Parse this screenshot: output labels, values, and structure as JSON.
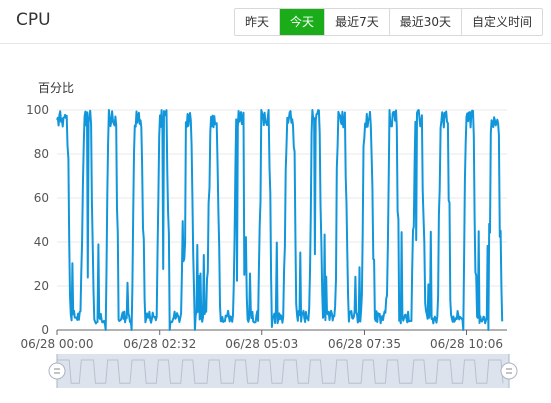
{
  "header": {
    "title": "CPU",
    "range_tabs": [
      {
        "label": "昨天",
        "active": false
      },
      {
        "label": "今天",
        "active": true
      },
      {
        "label": "最近7天",
        "active": false
      },
      {
        "label": "最近30天",
        "active": false
      },
      {
        "label": "自定义时间",
        "active": false
      }
    ]
  },
  "colors": {
    "accent": "#1aad19",
    "series": "#1296db",
    "grid": "#e8e8e8",
    "slider_bg": "#dde3ec"
  },
  "chart_data": {
    "type": "line",
    "ylabel": "百分比",
    "ylim": [
      0,
      100
    ],
    "yticks": [
      "0",
      "20",
      "40",
      "60",
      "80",
      "100"
    ],
    "xticks": [
      "06/28 00:00",
      "06/28 02:32",
      "06/28 05:03",
      "06/28 07:35",
      "06/28 10:06"
    ],
    "grid": true,
    "series": [
      {
        "peaks": [
          {
            "start": "06/28 00:00",
            "end": "06/28 00:15",
            "value": 100
          },
          {
            "start": "06/28 00:40",
            "end": "06/28 00:50",
            "value": 100
          },
          {
            "start": "06/28 01:17",
            "end": "06/28 01:27",
            "value": 100
          },
          {
            "start": "06/28 01:55",
            "end": "06/28 02:05",
            "value": 100
          },
          {
            "start": "06/28 02:32",
            "end": "06/28 02:42",
            "value": 100
          },
          {
            "start": "06/28 03:09",
            "end": "06/28 03:19",
            "value": 100
          },
          {
            "start": "06/28 03:47",
            "end": "06/28 03:57",
            "value": 100
          },
          {
            "start": "06/28 04:26",
            "end": "06/28 04:36",
            "value": 100
          },
          {
            "start": "06/28 05:03",
            "end": "06/28 05:13",
            "value": 100
          },
          {
            "start": "06/28 05:40",
            "end": "06/28 05:50",
            "value": 100
          },
          {
            "start": "06/28 06:18",
            "end": "06/28 06:28",
            "value": 100
          },
          {
            "start": "06/28 06:56",
            "end": "06/28 07:06",
            "value": 100
          },
          {
            "start": "06/28 07:35",
            "end": "06/28 07:45",
            "value": 100
          },
          {
            "start": "06/28 08:12",
            "end": "06/28 08:22",
            "value": 100
          },
          {
            "start": "06/28 08:50",
            "end": "06/28 09:00",
            "value": 100
          },
          {
            "start": "06/28 09:28",
            "end": "06/28 09:38",
            "value": 100
          },
          {
            "start": "06/28 10:06",
            "end": "06/28 10:16",
            "value": 100
          },
          {
            "start": "06/28 10:43",
            "end": "06/28 10:53",
            "value": 100
          }
        ],
        "baseline_value": 3
      }
    ]
  }
}
